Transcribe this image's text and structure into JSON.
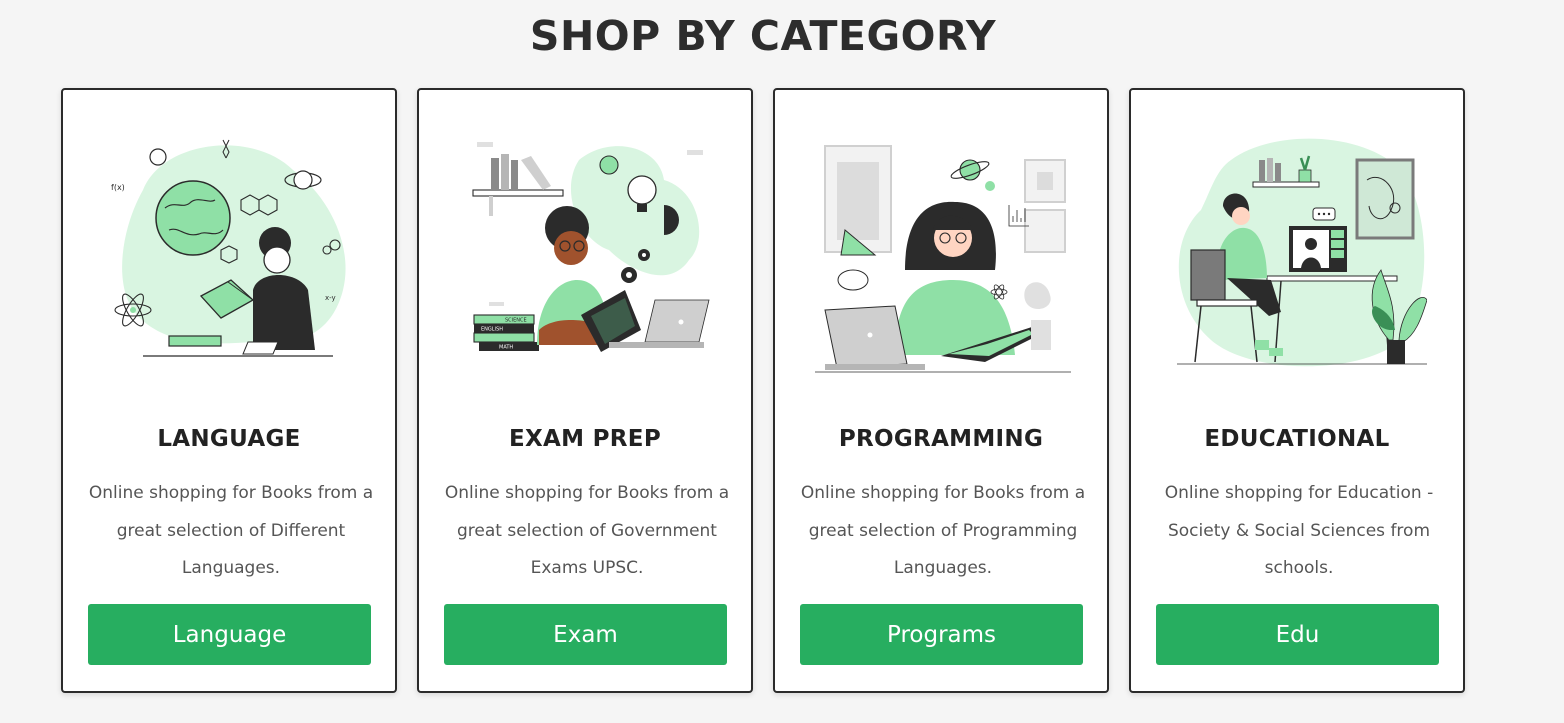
{
  "section": {
    "title": "SHOP BY CATEGORY"
  },
  "colors": {
    "accent": "#27ae60",
    "illustration_green": "#8fe0a6",
    "illustration_light": "#d9f5e1",
    "background": "#f5f5f5"
  },
  "cards": [
    {
      "title": "LANGUAGE",
      "description": "Online shopping for Books from a great selection of Different Languages.",
      "button_label": "Language",
      "illustration": "person-reading-globe-illustration"
    },
    {
      "title": "EXAM PREP",
      "description": "Online shopping for Books from a great selection of Government Exams UPSC.",
      "button_label": "Exam",
      "illustration": "student-studying-books-illustration"
    },
    {
      "title": "PROGRAMMING",
      "description": "Online shopping for Books from a great selection of Programming Languages.",
      "button_label": "Programs",
      "illustration": "woman-laptop-book-illustration"
    },
    {
      "title": "EDUCATIONAL",
      "description": "Online shopping for Education - Society & Social Sciences from schools.",
      "button_label": "Edu",
      "illustration": "online-class-desk-illustration"
    }
  ],
  "book_spine_labels": [
    "SCIENCE",
    "ENGLISH",
    "MATH"
  ]
}
